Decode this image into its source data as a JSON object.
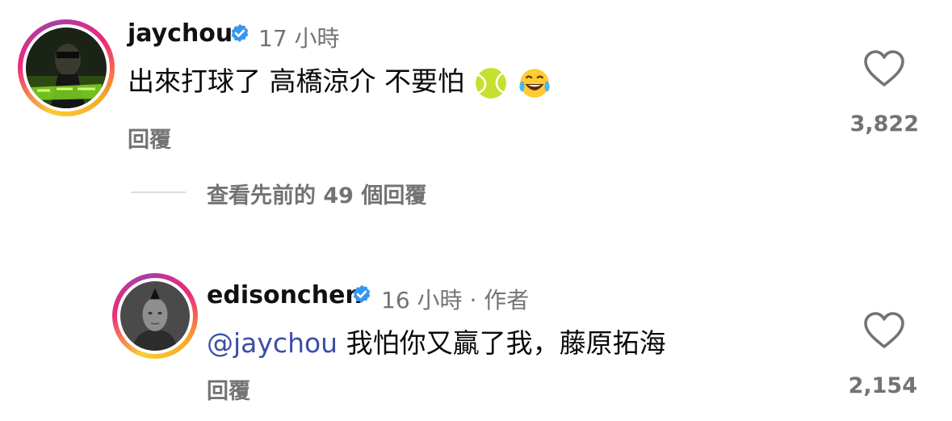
{
  "comments": [
    {
      "username": "jaychou",
      "time": "17 小時",
      "text": "出來打球了 高橋涼介 不要怕",
      "emojis": [
        "tennis-ball",
        "tears-of-joy"
      ],
      "reply_label": "回覆",
      "likes": "3,822"
    },
    {
      "username": "edisonchen",
      "time": "16 小時",
      "separator": "·",
      "author_badge": "作者",
      "mention": "@jaychou",
      "text": "我怕你又贏了我，藤原拓海",
      "reply_label": "回覆",
      "likes": "2,154"
    }
  ],
  "view_previous": "查看先前的 49 個回覆",
  "colors": {
    "verified": "#3797f0",
    "mention": "#3b4fa8",
    "secondary": "#737373"
  }
}
